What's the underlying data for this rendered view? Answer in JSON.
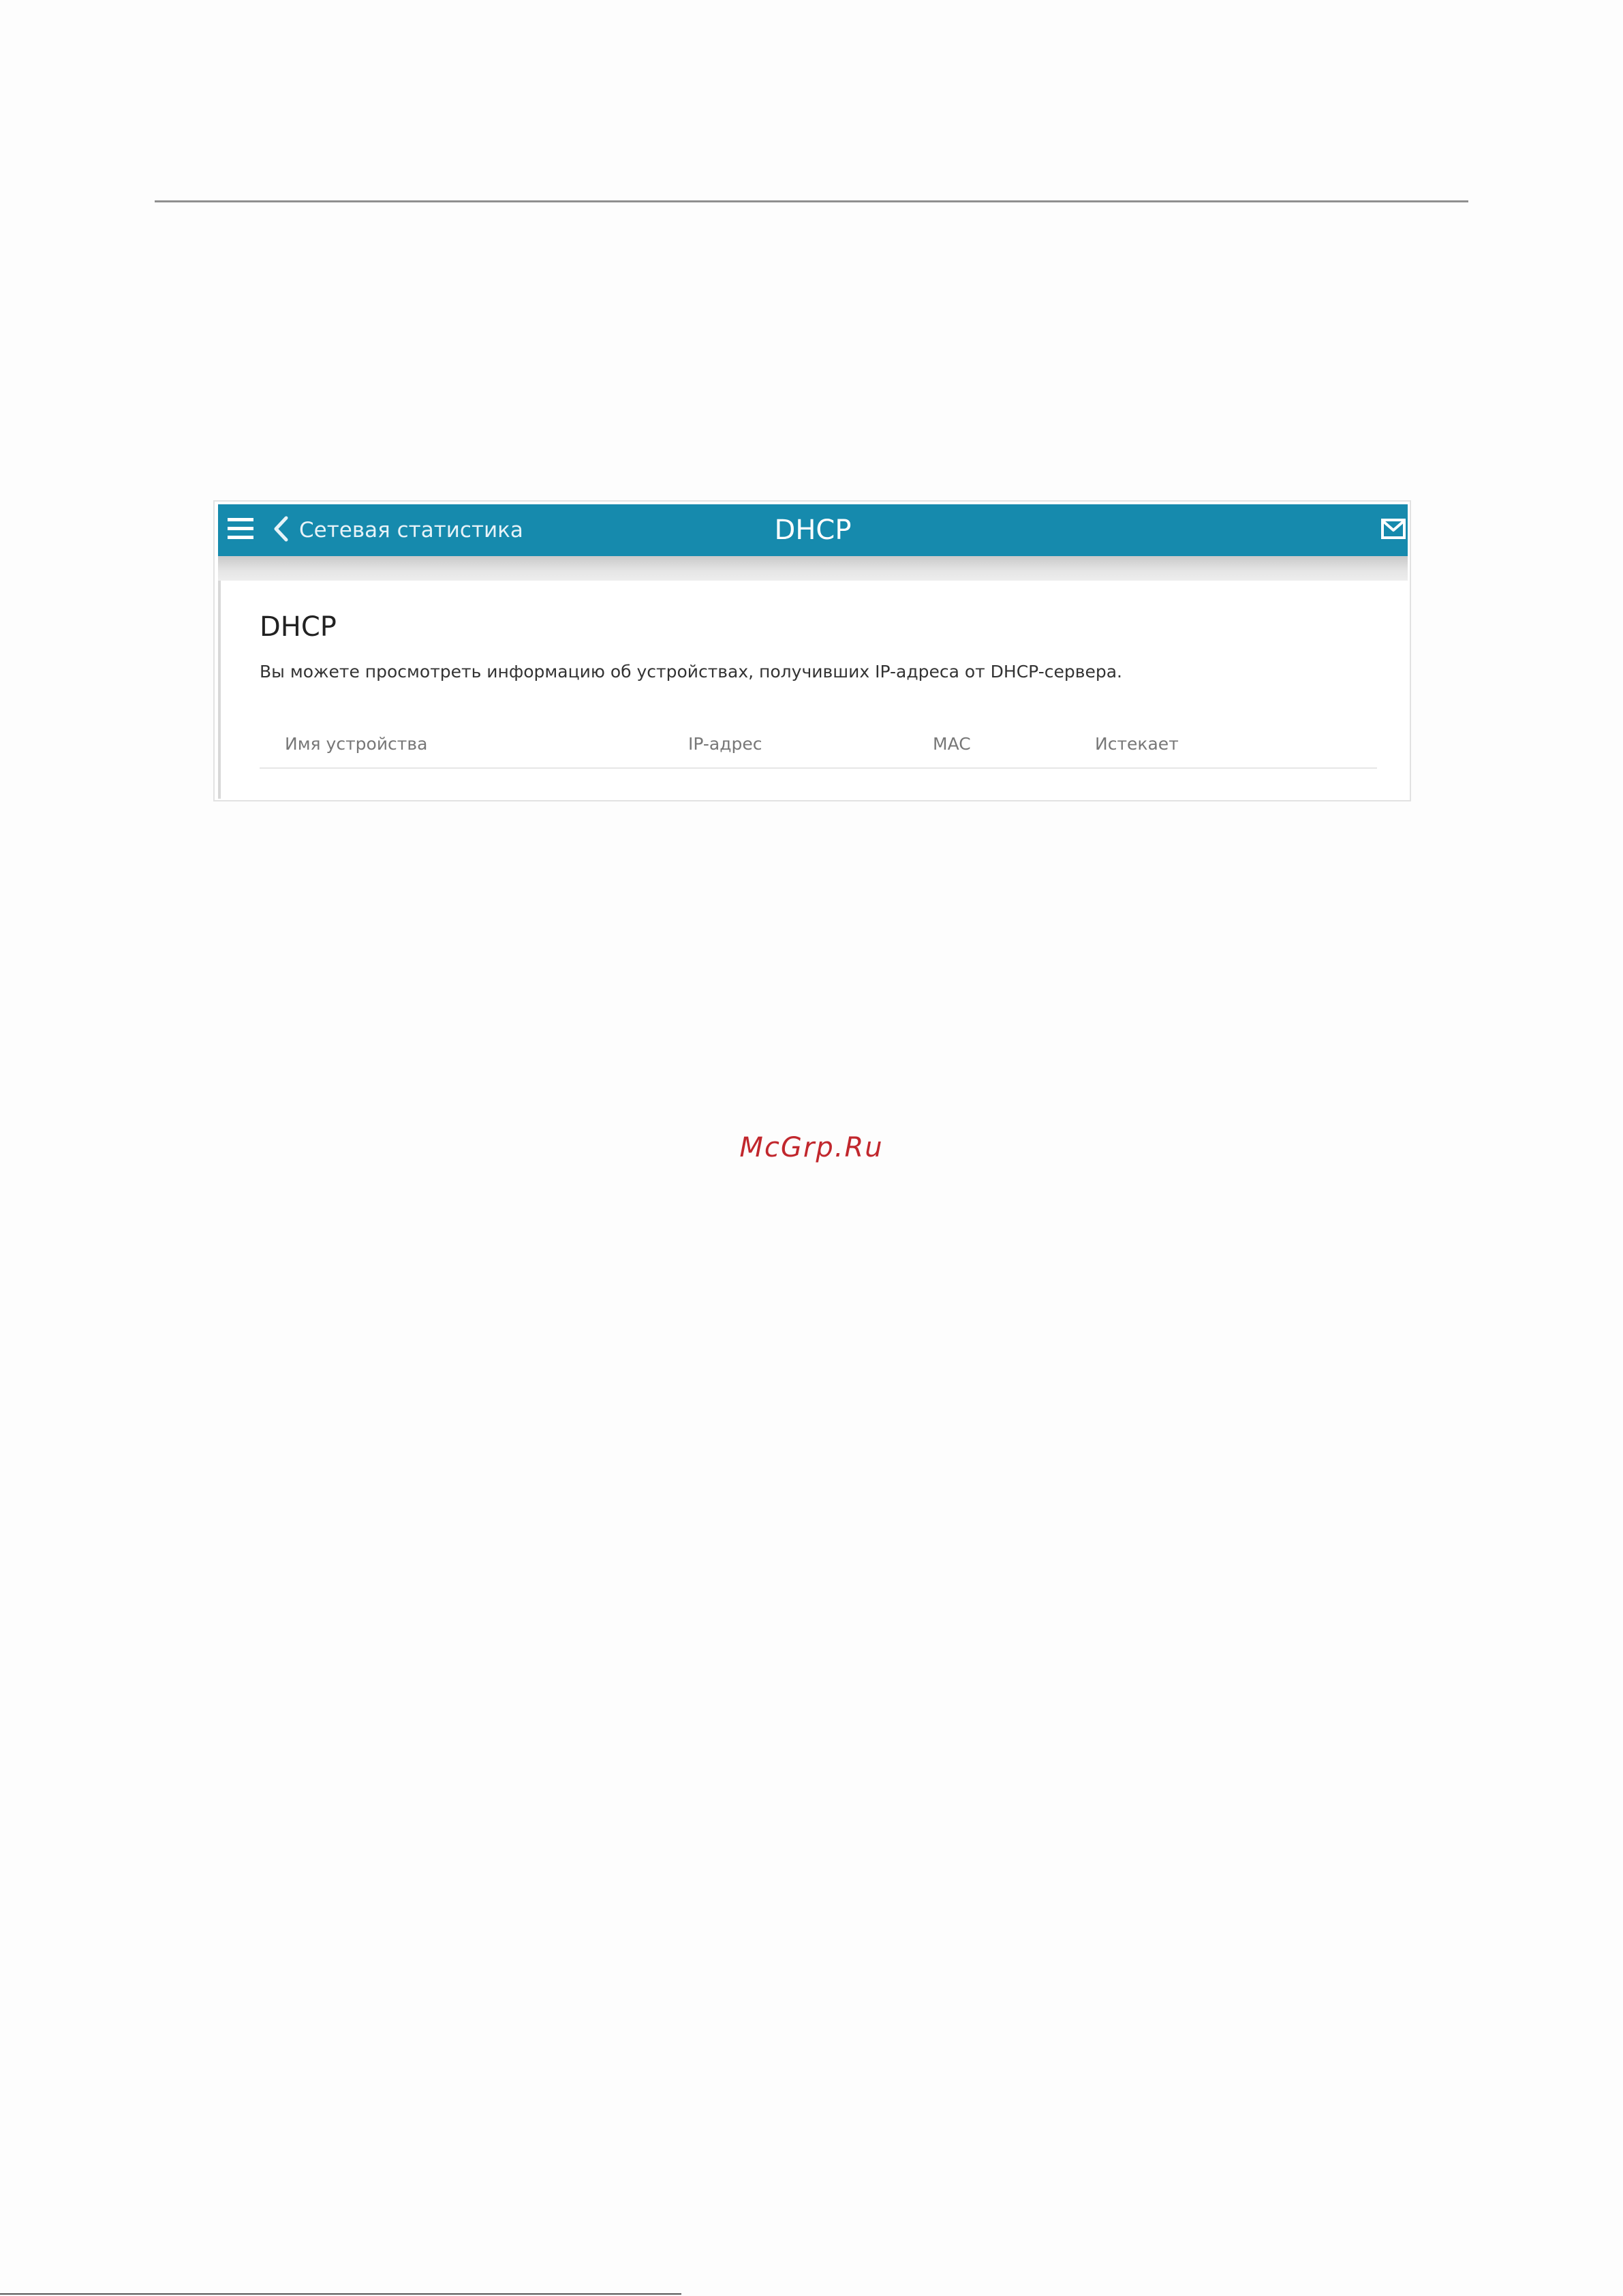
{
  "app": {
    "header": {
      "menu_icon": "hamburger-menu-icon",
      "back_icon": "chevron-left-icon",
      "back_label": "Сетевая статистика",
      "title": "DHCP",
      "mail_icon": "envelope-icon",
      "background_color": "#168aad"
    },
    "section": {
      "title": "DHCP",
      "description": "Вы можете просмотреть информацию об устройствах, получивших IP-адреса от DHCP-сервера."
    },
    "table": {
      "columns": [
        "Имя устройства",
        "IP-адрес",
        "MAC",
        "Истекает"
      ],
      "rows": []
    }
  },
  "watermark": {
    "text": "McGrp.Ru",
    "color": "#c1272d"
  }
}
